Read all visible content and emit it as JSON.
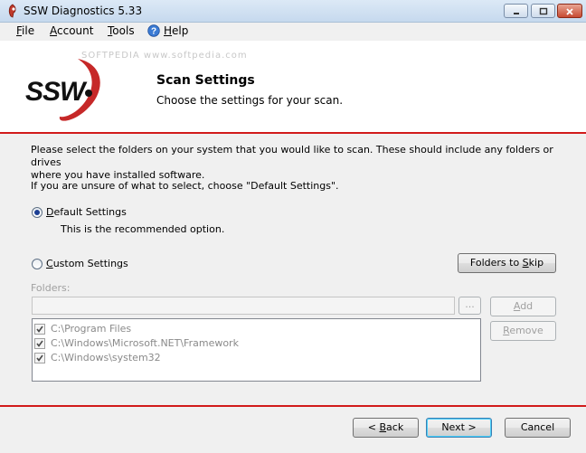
{
  "window": {
    "title": "SSW Diagnostics 5.33"
  },
  "menu": {
    "file": {
      "accel": "F",
      "rest": "ile"
    },
    "account": {
      "accel": "A",
      "rest": "ccount"
    },
    "tools": {
      "accel": "T",
      "rest": "ools"
    },
    "help": {
      "accel": "H",
      "rest": "elp"
    }
  },
  "header": {
    "logo_text": "SSW",
    "watermark": "SOFTPEDIA www.softpedia.com",
    "title": "Scan Settings",
    "subtitle": "Choose the settings for your scan."
  },
  "body": {
    "intro_line1": "Please select the folders on your system that you would like to scan. These should include any folders or drives",
    "intro_line2": "where you have installed software.",
    "unsure_text": "If you are unsure of what to select, choose \"Default Settings\".",
    "default_option": {
      "accel": "D",
      "rest": "efault Settings",
      "selected": true
    },
    "default_desc": "This is the recommended option.",
    "custom_option": {
      "accel": "C",
      "rest": "ustom Settings",
      "selected": false
    },
    "folders_to_skip_button": {
      "main": "Folders to ",
      "accel": "S",
      "rest": "kip"
    },
    "folders_label": "Folders:",
    "folder_input_value": "",
    "browse_button": "...",
    "add_button": {
      "accel": "A",
      "rest": "dd"
    },
    "remove_button": {
      "accel": "R",
      "rest": "emove"
    },
    "folders": [
      {
        "path": "C:\\Program Files",
        "checked": true
      },
      {
        "path": "C:\\Windows\\Microsoft.NET\\Framework",
        "checked": true
      },
      {
        "path": "C:\\Windows\\system32",
        "checked": true
      }
    ]
  },
  "footer": {
    "back_button": {
      "prefix": "< ",
      "accel": "B",
      "rest": "ack"
    },
    "next_button": "Next >",
    "cancel_button": "Cancel"
  },
  "colors": {
    "accent_red": "#d11b1b",
    "radio_dot": "#1c3f94"
  }
}
